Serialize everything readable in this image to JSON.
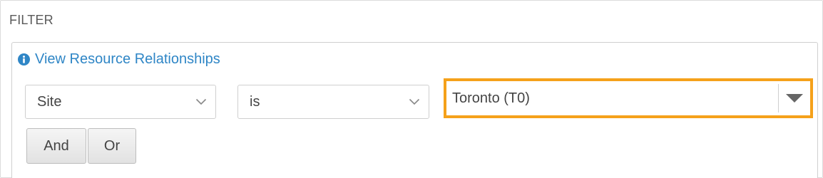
{
  "filter": {
    "heading": "FILTER",
    "view_link": {
      "label": "View Resource Relationships",
      "icon": "info-circle-icon"
    },
    "rule": {
      "attribute": {
        "selected": "Site",
        "icon": "chevron-down-icon"
      },
      "operator": {
        "selected": "is",
        "icon": "chevron-down-icon"
      },
      "value": {
        "selected": "Toronto (T0)",
        "icon": "triangle-down-icon"
      }
    },
    "buttons": {
      "and_label": "And",
      "or_label": "Or"
    },
    "colors": {
      "link": "#2f86c6",
      "focus_outline": "#f5a11a",
      "text": "#444444"
    }
  }
}
